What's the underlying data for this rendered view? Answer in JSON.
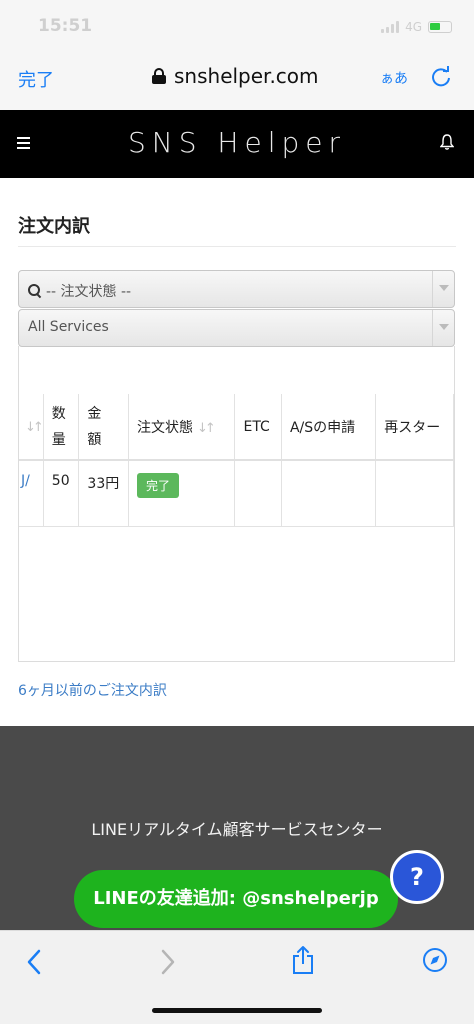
{
  "status": {
    "time": "15:51",
    "network": "4G"
  },
  "safari": {
    "done_label": "完了",
    "url": "snshelper.com",
    "aa_label": "ぁあ"
  },
  "header": {
    "title": "SNS Helper"
  },
  "page": {
    "title": "注文内訳"
  },
  "filters": {
    "status_select": "-- 注文状態 --",
    "service_select": "All Services"
  },
  "table": {
    "columns": [
      "数量",
      "金額",
      "注文状態",
      "ETC",
      "A/Sの申請",
      "再スター"
    ],
    "qty_header": [
      "数",
      "量"
    ],
    "amount_header": [
      "金",
      "額"
    ],
    "row": {
      "link_fragment": "J/",
      "qty": "50",
      "amount": "33円",
      "status": "完了"
    }
  },
  "history_link": "6ヶ月以前のご注文内訳",
  "footer": {
    "support_text": "LINEリアルタイム顧客サービスセンター",
    "line_button": "LINEの友達追加: @snshelperjp",
    "help_label": "?"
  },
  "colors": {
    "link": "#3b7cc6",
    "badge_green": "#5cb85c",
    "line_green": "#1eb31e",
    "help_blue": "#2a56d8",
    "ios_blue": "#1a7ef5"
  },
  "icons": [
    "lock-icon",
    "reload-icon",
    "menu-icon",
    "bell-icon",
    "search-icon",
    "sort-icon",
    "back-icon",
    "forward-icon",
    "share-icon",
    "compass-icon"
  ]
}
